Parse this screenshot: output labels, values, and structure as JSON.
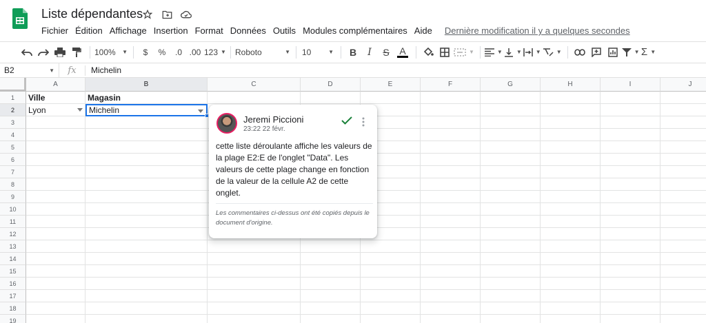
{
  "doc": {
    "title": "Liste dépendantes"
  },
  "menu": {
    "items": [
      "Fichier",
      "Édition",
      "Affichage",
      "Insertion",
      "Format",
      "Données",
      "Outils",
      "Modules complémentaires",
      "Aide"
    ],
    "last_edit": "Dernière modification il y a quelques secondes"
  },
  "toolbar": {
    "zoom": "100%",
    "currency": "$",
    "percent": "%",
    "dec_less": ".0",
    "dec_more": ".00",
    "more_formats": "123",
    "font": "Roboto",
    "font_size": "10",
    "bold": "B",
    "italic": "I",
    "strike": "S",
    "text_color": "A",
    "sum": "Σ"
  },
  "formula_bar": {
    "cell_ref": "B2",
    "fx": "fx",
    "value": "Michelin"
  },
  "grid": {
    "columns": [
      "A",
      "B",
      "C",
      "D",
      "E",
      "F",
      "G",
      "H",
      "I",
      "J"
    ],
    "rows": [
      "1",
      "2",
      "3",
      "4",
      "5",
      "6",
      "7",
      "8",
      "9",
      "10",
      "11",
      "12",
      "13",
      "14",
      "15",
      "16",
      "17",
      "18",
      "19"
    ],
    "cells": {
      "A1": "Ville",
      "B1": "Magasin",
      "A2": "Lyon",
      "B2": "Michelin"
    },
    "selected": "B2"
  },
  "comment": {
    "author": "Jeremi Piccioni",
    "time": "23:22 22 févr.",
    "body": "cette liste déroulante affiche les valeurs de la plage E2:E de l'onglet \"Data\". Les valeurs de cette plage change en fonction de la valeur de la cellule A2 de cette onglet.",
    "note": "Les commentaires ci-dessus ont été copiés depuis le document d'origine."
  },
  "colors": {
    "accent": "#1a73e8",
    "sheets_green": "#0f9d58",
    "resolve_green": "#188038",
    "avatar_ring": "#e91e63"
  }
}
